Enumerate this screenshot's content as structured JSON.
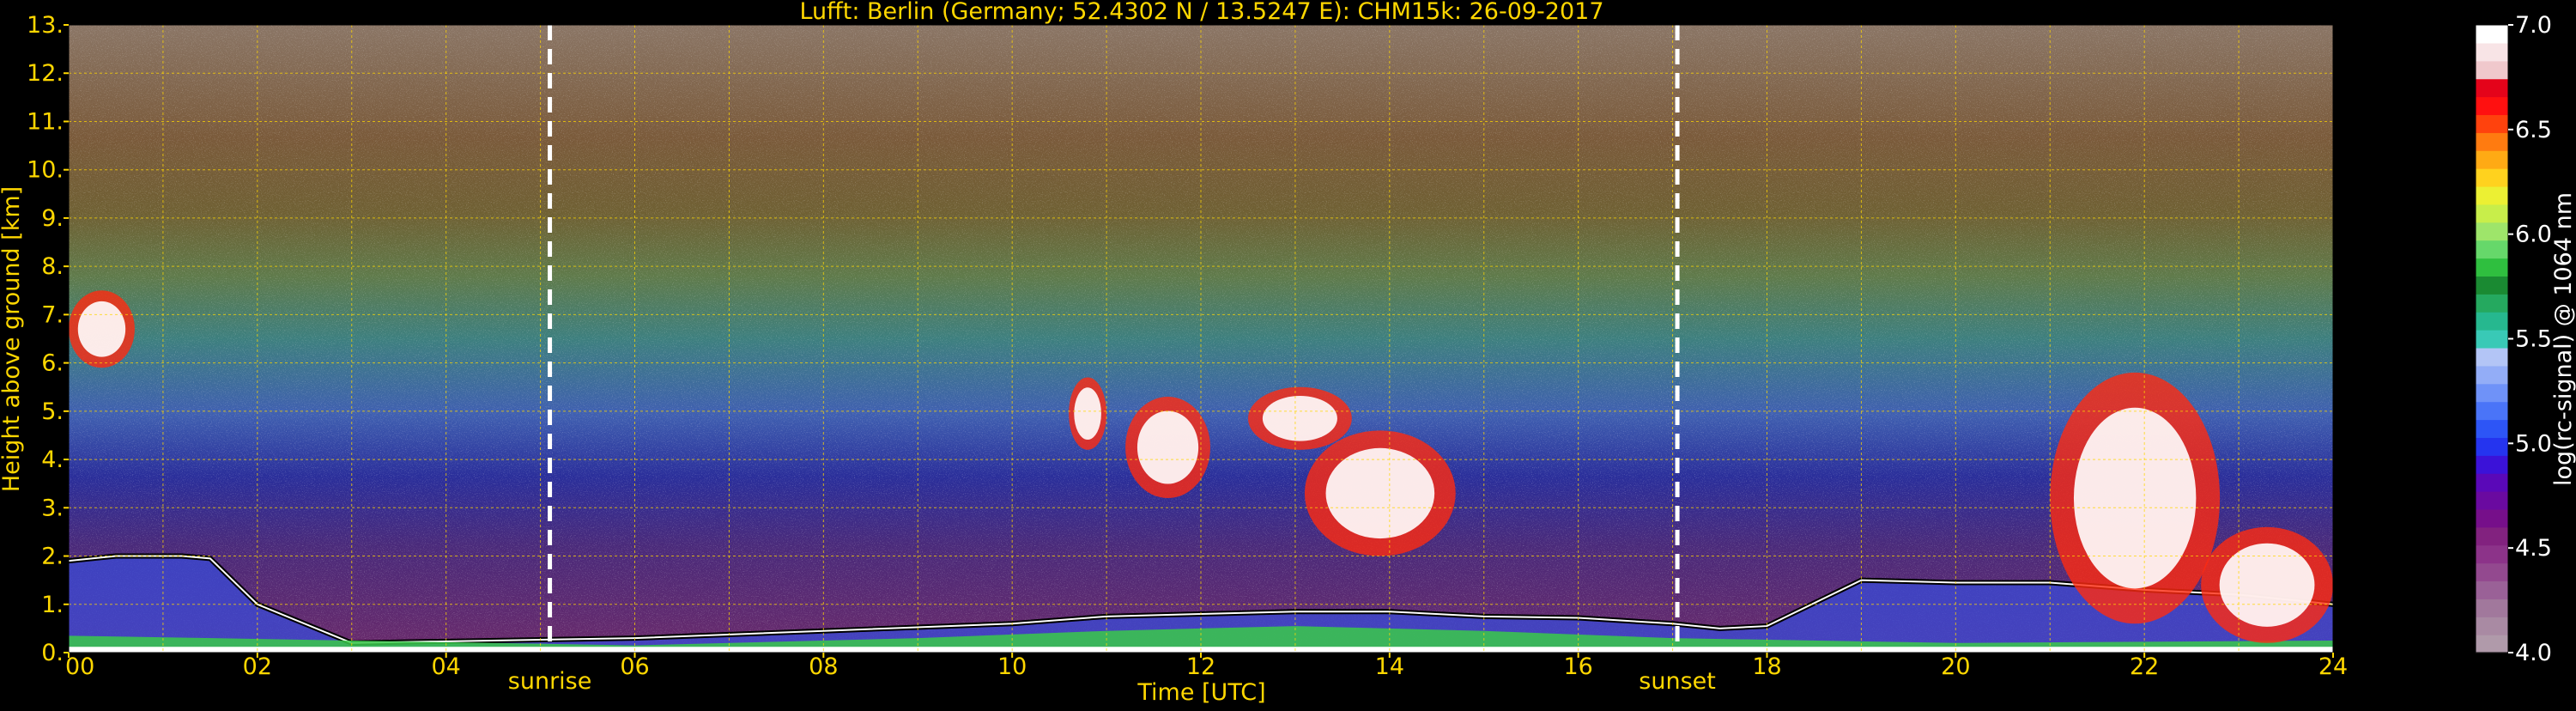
{
  "chart_data": {
    "type": "heatmap",
    "title": "Lufft: Berlin (Germany; 52.4302 N / 13.5247 E):    CHM15k: 26-09-2017",
    "xlabel": "Time [UTC]",
    "ylabel": "Height above ground [km]",
    "xlim": [
      0,
      24
    ],
    "ylim": [
      0,
      13
    ],
    "x_ticks": [
      "00",
      "02",
      "04",
      "06",
      "08",
      "10",
      "12",
      "14",
      "16",
      "18",
      "20",
      "22",
      "24"
    ],
    "y_ticks": [
      "0.",
      "1.",
      "2.",
      "3.",
      "4.",
      "5.",
      "6.",
      "7.",
      "8.",
      "9.",
      "10.",
      "11.",
      "12.",
      "13."
    ],
    "grid": true,
    "markers": [
      {
        "label": "sunrise",
        "x": 5.1
      },
      {
        "label": "sunset",
        "x": 17.05
      }
    ],
    "colorbar": {
      "label": "log(rc-signal) @ 1064 nm",
      "range": [
        4.0,
        7.0
      ],
      "ticks": [
        "4.0",
        "4.5",
        "5.0",
        "5.5",
        "6.0",
        "6.5",
        "7.0"
      ],
      "colors": [
        "#b09aaa",
        "#a98aa3",
        "#a1789c",
        "#9a6197",
        "#93498f",
        "#8c3389",
        "#82227f",
        "#760f8a",
        "#6a0aa0",
        "#5a08b8",
        "#3b12d8",
        "#2534ef",
        "#2d55f6",
        "#4a74f8",
        "#6f92f8",
        "#93adf7",
        "#b3c5f6",
        "#39c9b6",
        "#26b88f",
        "#25a95f",
        "#1a8a32",
        "#2fbf3f",
        "#66d86a",
        "#9ee56a",
        "#c8ee4a",
        "#ecf033",
        "#ffd21e",
        "#ffaa14",
        "#ff7b10",
        "#ff420d",
        "#ff1010",
        "#e4031a",
        "#f0c8cc",
        "#f8e4e6",
        "#ffffff"
      ]
    },
    "features": [
      {
        "kind": "boundary-layer-top",
        "points": [
          [
            0,
            1.9
          ],
          [
            0.5,
            2.0
          ],
          [
            1.2,
            2.0
          ],
          [
            1.5,
            1.95
          ],
          [
            2.0,
            1.0
          ],
          [
            3.0,
            0.2
          ],
          [
            6,
            0.3
          ],
          [
            8,
            0.45
          ],
          [
            10,
            0.6
          ],
          [
            11,
            0.75
          ],
          [
            12,
            0.8
          ],
          [
            13,
            0.85
          ],
          [
            14,
            0.85
          ],
          [
            15,
            0.75
          ],
          [
            16,
            0.72
          ],
          [
            17,
            0.6
          ],
          [
            17.5,
            0.5
          ],
          [
            18,
            0.55
          ],
          [
            19,
            1.5
          ],
          [
            20,
            1.45
          ],
          [
            21,
            1.45
          ],
          [
            22,
            1.3
          ],
          [
            23,
            1.2
          ],
          [
            24,
            1.0
          ]
        ]
      },
      {
        "kind": "cloud",
        "x": [
          10.6,
          11.0
        ],
        "y": [
          4.2,
          5.7
        ]
      },
      {
        "kind": "cloud",
        "x": [
          11.2,
          12.1
        ],
        "y": [
          3.2,
          5.3
        ]
      },
      {
        "kind": "cloud",
        "x": [
          12.5,
          13.6
        ],
        "y": [
          4.2,
          5.5
        ]
      },
      {
        "kind": "cloud",
        "x": [
          13.1,
          14.7
        ],
        "y": [
          2.0,
          4.6
        ]
      },
      {
        "kind": "cloud",
        "x": [
          0.0,
          0.7
        ],
        "y": [
          5.9,
          7.5
        ]
      },
      {
        "kind": "cloud",
        "x": [
          21.0,
          22.8
        ],
        "y": [
          0.6,
          5.8
        ]
      },
      {
        "kind": "cloud",
        "x": [
          22.6,
          24.0
        ],
        "y": [
          0.2,
          2.6
        ]
      }
    ]
  }
}
